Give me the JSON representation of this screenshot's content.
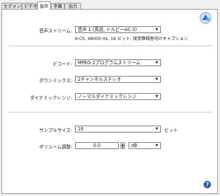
{
  "tabs": [
    {
      "label": "セグメント",
      "active": false
    },
    {
      "label": "ビデオ",
      "active": false
    },
    {
      "label": "音声",
      "active": true
    },
    {
      "label": "字幕",
      "active": false
    },
    {
      "label": "出力",
      "active": false
    }
  ],
  "audio_stream": {
    "label": "音声ストリーム:",
    "value": "音声 1 (英語, ドルビーAC-3)",
    "info": "6-Ch, 48000 Hz, 16 ビット, 視覚障碍者向けキャプション"
  },
  "decode": {
    "label": "デコード:",
    "value": "MPEG-2プログラムストリーム"
  },
  "downmix": {
    "label": "ダウンミックス:",
    "value": "2チャンネルステレオ"
  },
  "dynamic_range": {
    "label": "ダイナミックレンジ:",
    "value": "ノーマルダイナミックレンジ"
  },
  "sample_size": {
    "label": "サンプルサイズ:",
    "value": "16",
    "unit": "ビット"
  },
  "volume": {
    "label": "ボリューム調整:",
    "value": "0.0",
    "unit_value": "dB"
  },
  "icons": {
    "logo": "app-logo-icon",
    "help": "help-icon",
    "accent": "#2a6ac8"
  }
}
